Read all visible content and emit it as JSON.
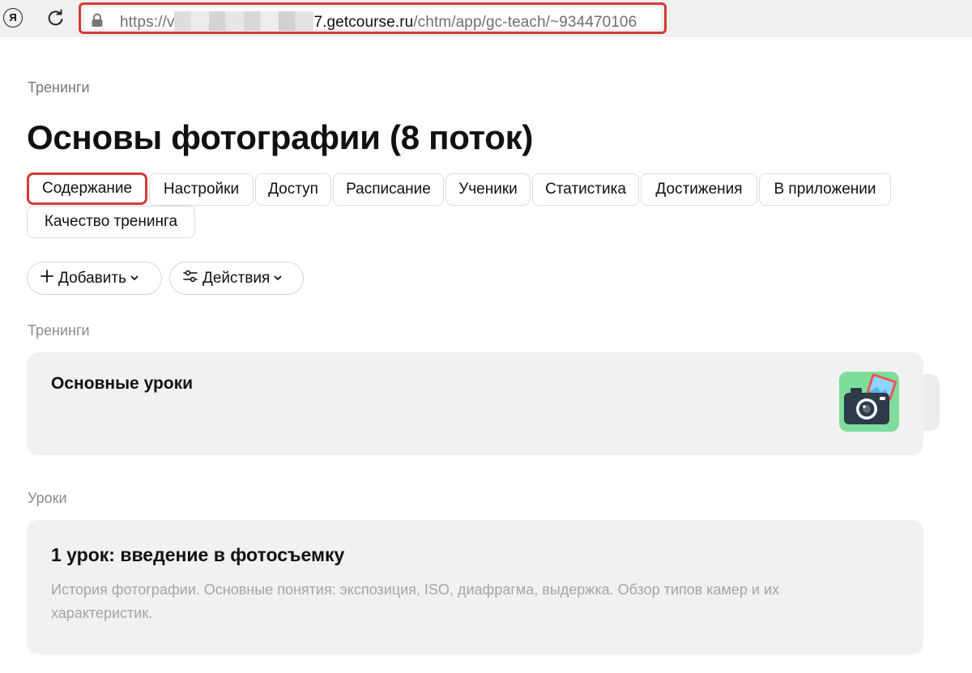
{
  "browser": {
    "yandex_glyph": "Я",
    "url_scheme": "https://",
    "url_obscured_prefix": "v",
    "url_host_tail": "7.getcourse.ru",
    "url_path": "/chtm/app/gc-teach/~934470106"
  },
  "breadcrumb": "Тренинги",
  "title": "Основы фотографии (8 поток)",
  "tabs": [
    {
      "label": "Содержание",
      "active": true
    },
    {
      "label": "Настройки"
    },
    {
      "label": "Доступ"
    },
    {
      "label": "Расписание"
    },
    {
      "label": "Ученики"
    },
    {
      "label": "Статистика"
    },
    {
      "label": "Достижения"
    },
    {
      "label": "В приложении"
    },
    {
      "label": "Качество тренинга"
    }
  ],
  "toolbar": {
    "add_label": "Добавить",
    "actions_label": "Действия"
  },
  "trainings_section": {
    "label": "Тренинги",
    "items": [
      {
        "title": "Основные уроки",
        "cover_icon": "camera-photo-icon"
      }
    ]
  },
  "lessons_section": {
    "label": "Уроки",
    "items": [
      {
        "title": "1 урок: введение в фотосъемку",
        "description": "История фотографии. Основные понятия: экспозиция, ISO, диафрагма, выдержка. Обзор типов камер и их характеристик."
      }
    ]
  },
  "colors": {
    "highlight": "#d43a36",
    "card_bg": "#f1f1f1",
    "cover_bg": "#7edc9c"
  }
}
